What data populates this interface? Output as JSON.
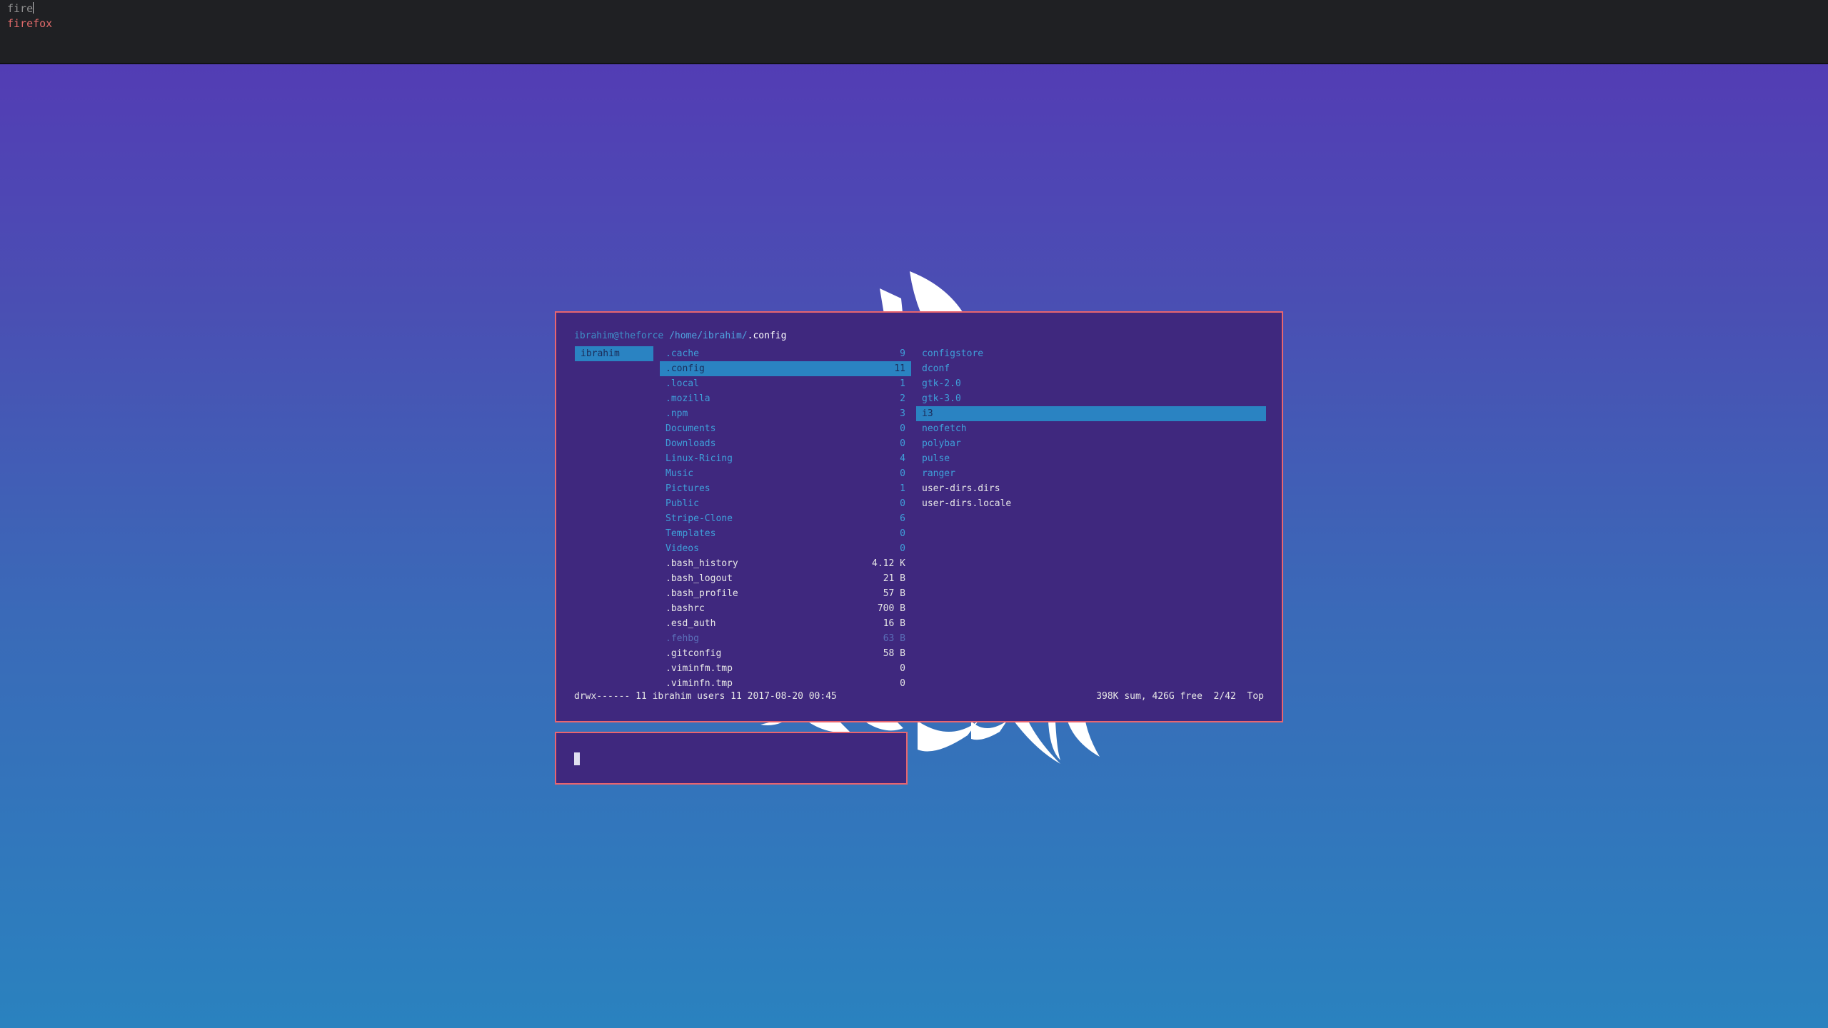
{
  "launcher": {
    "query": "fire",
    "results": [
      "firefox"
    ]
  },
  "terminal": {
    "header": {
      "host": "ibrahim@theforce",
      "path": "/home/ibrahim/",
      "current": ".config"
    },
    "parent_column": [
      {
        "name": "ibrahim",
        "type": "dir",
        "selected": true
      }
    ],
    "main_column": [
      {
        "name": ".cache",
        "size": "9",
        "type": "dir"
      },
      {
        "name": ".config",
        "size": "11",
        "type": "dir",
        "selected": true
      },
      {
        "name": ".local",
        "size": "1",
        "type": "dir"
      },
      {
        "name": ".mozilla",
        "size": "2",
        "type": "dir"
      },
      {
        "name": ".npm",
        "size": "3",
        "type": "dir"
      },
      {
        "name": "Documents",
        "size": "0",
        "type": "dir"
      },
      {
        "name": "Downloads",
        "size": "0",
        "type": "dir"
      },
      {
        "name": "Linux-Ricing",
        "size": "4",
        "type": "dir"
      },
      {
        "name": "Music",
        "size": "0",
        "type": "dir"
      },
      {
        "name": "Pictures",
        "size": "1",
        "type": "dir"
      },
      {
        "name": "Public",
        "size": "0",
        "type": "dir"
      },
      {
        "name": "Stripe-Clone",
        "size": "6",
        "type": "dir"
      },
      {
        "name": "Templates",
        "size": "0",
        "type": "dir"
      },
      {
        "name": "Videos",
        "size": "0",
        "type": "dir"
      },
      {
        "name": ".bash_history",
        "size": "4.12 K",
        "type": "file"
      },
      {
        "name": ".bash_logout",
        "size": "21 B",
        "type": "file"
      },
      {
        "name": ".bash_profile",
        "size": "57 B",
        "type": "file"
      },
      {
        "name": ".bashrc",
        "size": "700 B",
        "type": "file"
      },
      {
        "name": ".esd_auth",
        "size": "16 B",
        "type": "file"
      },
      {
        "name": ".fehbg",
        "size": "63 B",
        "type": "dim"
      },
      {
        "name": ".gitconfig",
        "size": "58 B",
        "type": "file"
      },
      {
        "name": ".viminfm.tmp",
        "size": "0",
        "type": "file"
      },
      {
        "name": ".viminfn.tmp",
        "size": "0",
        "type": "file"
      }
    ],
    "preview_column": [
      {
        "name": "configstore",
        "type": "dir"
      },
      {
        "name": "dconf",
        "type": "dir"
      },
      {
        "name": "gtk-2.0",
        "type": "dir"
      },
      {
        "name": "gtk-3.0",
        "type": "dir"
      },
      {
        "name": "i3",
        "type": "dir",
        "selected": true
      },
      {
        "name": "neofetch",
        "type": "dir"
      },
      {
        "name": "polybar",
        "type": "dir"
      },
      {
        "name": "pulse",
        "type": "dir"
      },
      {
        "name": "ranger",
        "type": "dir"
      },
      {
        "name": "user-dirs.dirs",
        "type": "file"
      },
      {
        "name": "user-dirs.locale",
        "type": "file"
      }
    ],
    "status_left": "drwx------ 11 ibrahim users 11 2017-08-20 00:45",
    "status_right": "398K sum, 426G free  2/42  Top"
  },
  "colors": {
    "border": "#e8656f",
    "term_bg": "#3f287e",
    "selection": "#2a83c2",
    "dir": "#3fa0da",
    "launcher_match": "#e06a6a"
  }
}
